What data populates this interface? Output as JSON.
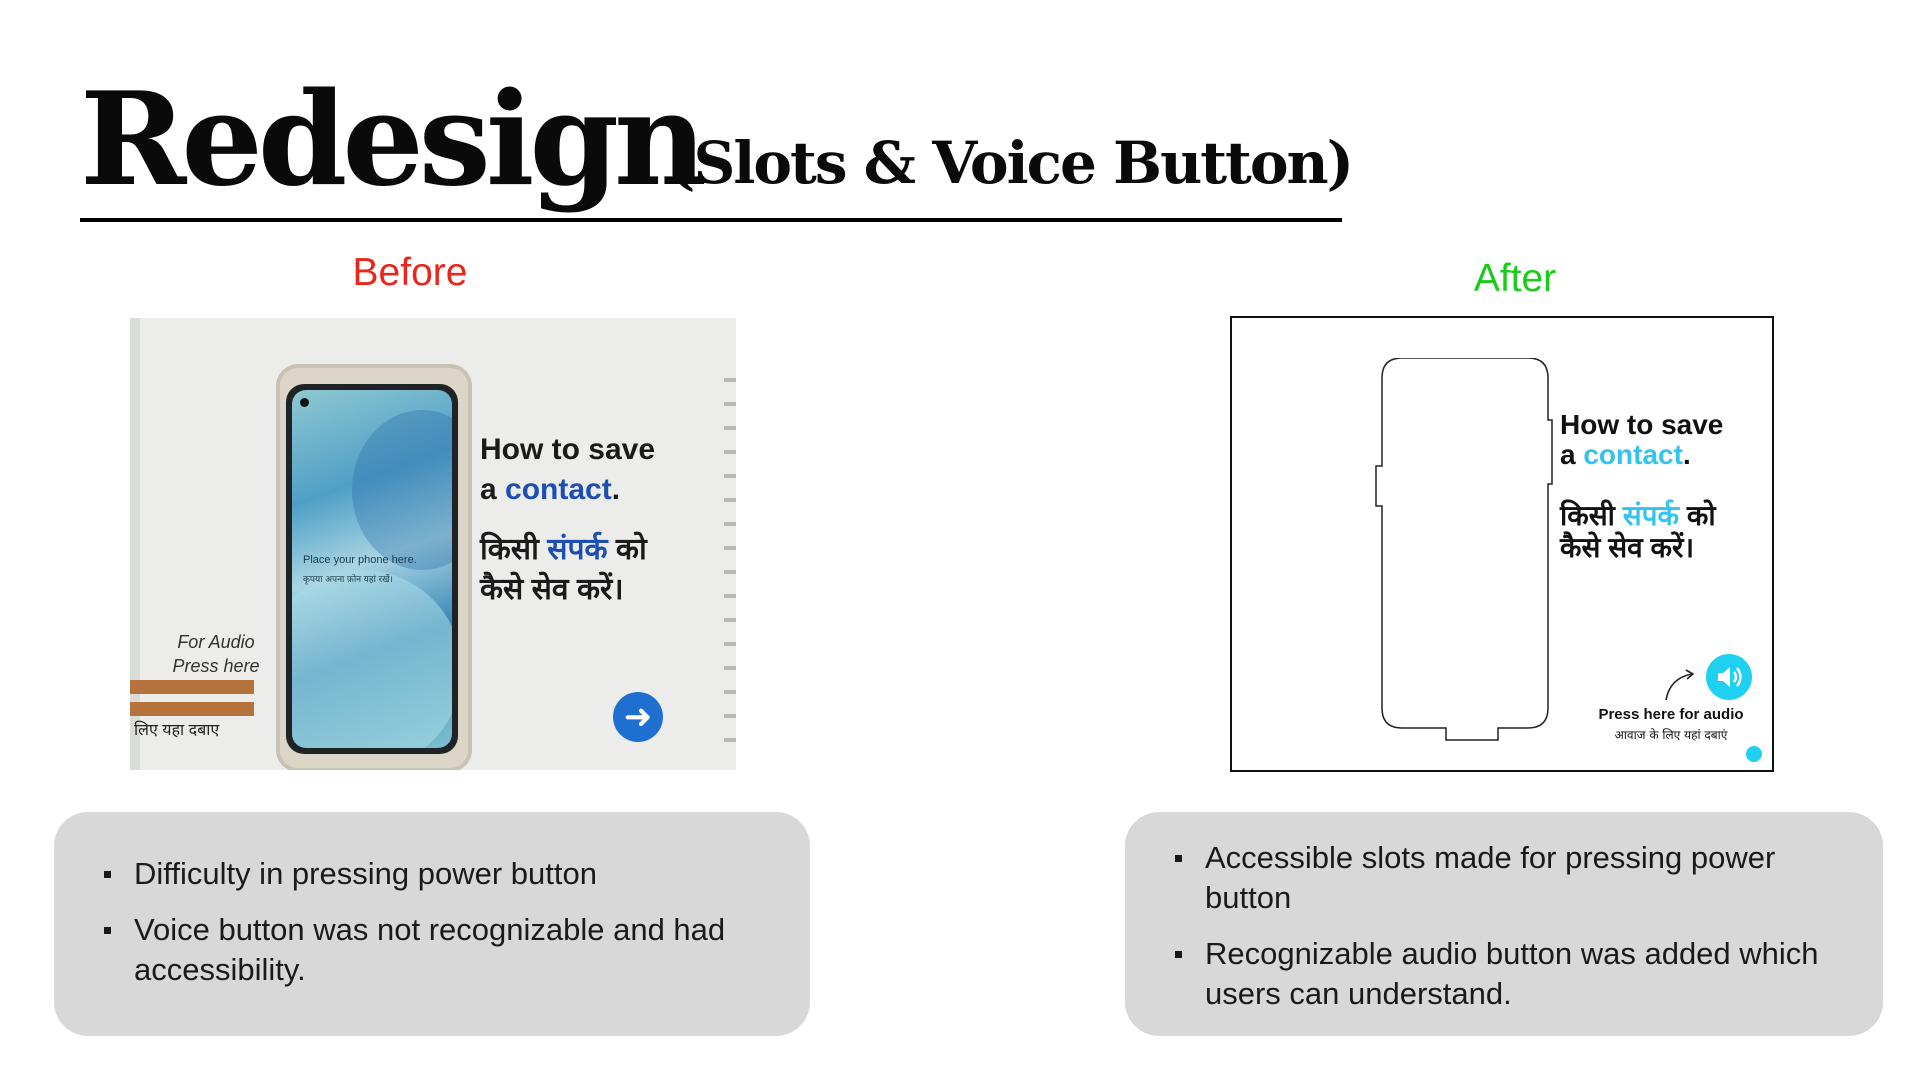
{
  "header": {
    "title": "Redesign",
    "subtitle": "(Slots & Voice Button)"
  },
  "before": {
    "label": "Before",
    "label_color": "#e8261e",
    "photo": {
      "screen_text_en": "Place your phone here.",
      "screen_text_hi": "कृपया अपना फ़ोन यहां रखें।",
      "heading_line1": "How to save",
      "heading_line2_prefix": "a ",
      "heading_line2_highlight": "contact",
      "heading_line2_suffix": ".",
      "hindi_prefix": "किसी ",
      "hindi_highlight": "संपर्क",
      "hindi_suffix": " को कैसे सेव करें।",
      "handwritten_line1": "For Audio",
      "handwritten_line2": "Press here",
      "handwritten_hindi": "लिए यहा दबाए",
      "next_icon": "arrow-right-icon",
      "highlight_color": "#1d4fb0"
    },
    "points": [
      "Difficulty in pressing power button",
      "Voice button was not recognizable and had accessibility."
    ]
  },
  "after": {
    "label": "After",
    "label_color": "#1bcb1b",
    "mockup": {
      "heading_line1": "How to save",
      "heading_line2_prefix": "a ",
      "heading_line2_highlight": "contact",
      "heading_line2_suffix": ".",
      "hindi_prefix": "किसी ",
      "hindi_highlight": "संपर्क",
      "hindi_suffix": " को कैसे सेव करें।",
      "audio_icon": "speaker-icon",
      "audio_label_en": "Press here for audio",
      "audio_label_hi": "आवाज के लिए यहां दबाएं",
      "highlight_color": "#32c4ee"
    },
    "points": [
      "Accessible slots made for pressing power button",
      "Recognizable audio button was added which users can understand."
    ]
  }
}
